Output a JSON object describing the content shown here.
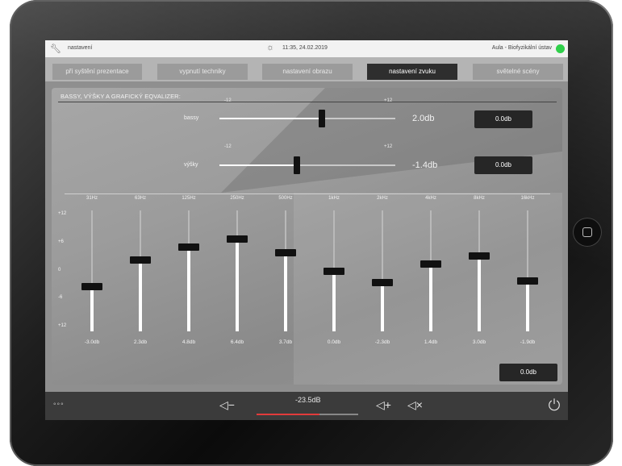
{
  "topbar": {
    "section_label": "nastavení",
    "datetime": "11:35, 24.02.2019",
    "room": "Aula - Biofyzikální ústav",
    "status_color": "#2fd04a"
  },
  "tabs": [
    {
      "label": "při sуštění prezentace",
      "active": false
    },
    {
      "label": "vypnutí techniky",
      "active": false
    },
    {
      "label": "nastavení obrazu",
      "active": false
    },
    {
      "label": "nastavení zvuku",
      "active": true
    },
    {
      "label": "světelné scény",
      "active": false
    }
  ],
  "section_title": "BASSY, VÝŠKY A GRAFICKÝ EQVALIZER:",
  "tone": [
    {
      "name": "bassy",
      "min_label": "-12",
      "max_label": "+12",
      "value_text": "2.0db",
      "value": 2.0,
      "box": "0.0db"
    },
    {
      "name": "výšky",
      "min_label": "-12",
      "max_label": "+12",
      "value_text": "-1.4db",
      "value": -1.4,
      "box": "0.0db"
    }
  ],
  "eq_scale": [
    "+12",
    "+6",
    "0",
    "-6",
    "+12"
  ],
  "eq_bands": [
    {
      "freq": "31Hz",
      "value": -3.0,
      "label": "-3.0db"
    },
    {
      "freq": "63Hz",
      "value": 2.3,
      "label": "2.3db"
    },
    {
      "freq": "125Hz",
      "value": 4.8,
      "label": "4.8db"
    },
    {
      "freq": "250Hz",
      "value": 6.4,
      "label": "6.4db"
    },
    {
      "freq": "500Hz",
      "value": 3.7,
      "label": "3.7db"
    },
    {
      "freq": "1kHz",
      "value": 0.0,
      "label": "0.0db"
    },
    {
      "freq": "2kHz",
      "value": -2.3,
      "label": "-2.3db"
    },
    {
      "freq": "4kHz",
      "value": 1.4,
      "label": "1.4db"
    },
    {
      "freq": "8kHz",
      "value": 3.0,
      "label": "3.0db"
    },
    {
      "freq": "16kHz",
      "value": -1.9,
      "label": "-1.9db"
    }
  ],
  "eq_box": "0.0db",
  "bottom": {
    "menu_icon": "more-dots-icon",
    "volume_text": "-23.5dB",
    "volume_level": 0.62,
    "volume_color": "#e23b3b"
  }
}
